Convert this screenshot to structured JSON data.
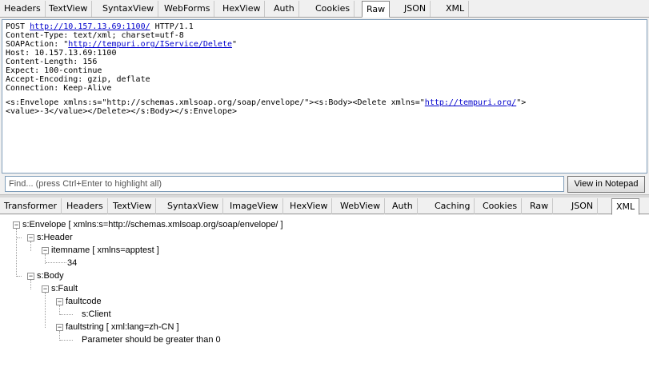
{
  "request_tabs": [
    "Headers",
    "TextView",
    "SyntaxView",
    "WebForms",
    "HexView",
    "Auth",
    "Cookies",
    "Raw",
    "JSON",
    "XML"
  ],
  "request_active_tab": "Raw",
  "raw": {
    "line1_method": "POST ",
    "line1_url": "http://10.157.13.69:1100/",
    "line1_proto": " HTTP/1.1",
    "content_type": "Content-Type: text/xml; charset=utf-8",
    "soapaction_prefix": "SOAPAction: \"",
    "soapaction_url": "http://tempuri.org/IService/Delete",
    "soapaction_suffix": "\"",
    "host": "Host: 10.157.13.69:1100",
    "content_length": "Content-Length: 156",
    "expect": "Expect: 100-continue",
    "accept_encoding": "Accept-Encoding: gzip, deflate",
    "connection": "Connection: Keep-Alive",
    "body1_prefix": "<s:Envelope xmlns:s=\"http://schemas.xmlsoap.org/soap/envelope/\"><s:Body><Delete xmlns=\"",
    "body1_url": "http://tempuri.org/",
    "body1_suffix": "\">",
    "body2": "<value>-3</value></Delete></s:Body></s:Envelope>"
  },
  "find": {
    "placeholder": "Find... (press Ctrl+Enter to highlight all)"
  },
  "notepad_button": "View in Notepad",
  "response_tabs": [
    "Transformer",
    "Headers",
    "TextView",
    "SyntaxView",
    "ImageView",
    "HexView",
    "WebView",
    "Auth",
    "Caching",
    "Cookies",
    "Raw",
    "JSON",
    "XML"
  ],
  "response_active_tab": "XML",
  "tree": {
    "envelope": "s:Envelope [ xmlns:s=http://schemas.xmlsoap.org/soap/envelope/ ]",
    "header": "s:Header",
    "itemname": "itemname [ xmlns=apptest ]",
    "itemname_value": "34",
    "body": "s:Body",
    "fault": "s:Fault",
    "faultcode": "faultcode",
    "faultcode_value": "s:Client",
    "faultstring": "faultstring [ xml:lang=zh-CN ]",
    "faultstring_value": "Parameter should be greater than 0"
  },
  "icons": {
    "collapse": "minus-box-icon"
  }
}
